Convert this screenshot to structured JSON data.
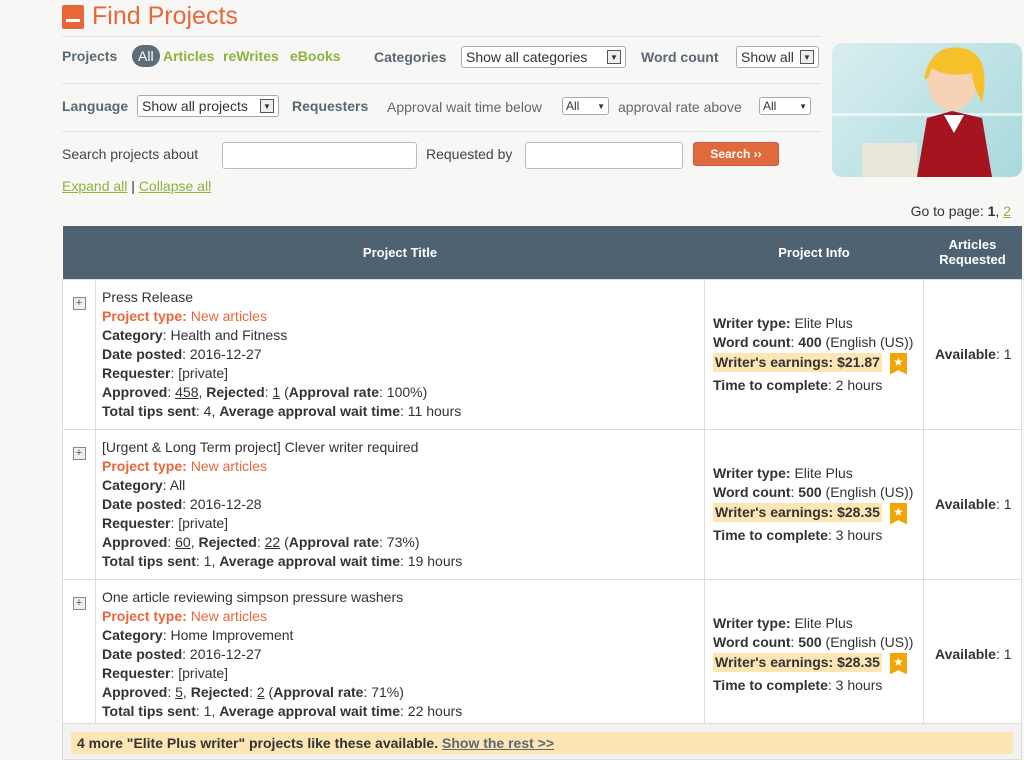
{
  "header": {
    "title": "Find Projects",
    "logo_icon": "notebook-pencil-icon"
  },
  "filters": {
    "projects_label": "Projects",
    "project_tabs": [
      "All",
      "Articles",
      "reWrites",
      "eBooks"
    ],
    "categories_label": "Categories",
    "categories_value": "Show all categories",
    "word_count_label": "Word count",
    "word_count_value": "Show all",
    "language_label": "Language",
    "language_value": "Show all projects",
    "requesters_label": "Requesters",
    "approval_wait_label": "Approval wait time below",
    "approval_wait_value": "All",
    "approval_rate_label": "approval rate above",
    "approval_rate_value": "All",
    "search_label": "Search projects about",
    "search_value": "",
    "requested_by_label": "Requested by",
    "requested_by_value": "",
    "search_button": "Search ››",
    "expand_all": "Expand all",
    "separator": "|",
    "collapse_all": "Collapse all"
  },
  "pagination": {
    "label": "Go to page:",
    "current": "1",
    "other": "2"
  },
  "table": {
    "headers": [
      "Project Title",
      "Project Info",
      "Articles Requested"
    ],
    "rows": [
      {
        "title": "Press Release",
        "type": "New articles",
        "category": "Health and Fitness",
        "date": "2016-12-27",
        "requester": "[private]",
        "approved": "458",
        "rejected": "1",
        "rate": "100%",
        "tips": "4",
        "wait": "11 hours",
        "writer_type": "Elite Plus",
        "word_count": "400",
        "language": "(English (US))",
        "earnings": "$21.87",
        "time": "2 hours",
        "available": "1"
      },
      {
        "title": "[Urgent & Long Term project] Clever writer required",
        "type": "New articles",
        "category": "All",
        "date": "2016-12-28",
        "requester": "[private]",
        "approved": "60",
        "rejected": "22",
        "rate": "73%",
        "tips": "1",
        "wait": "19 hours",
        "writer_type": "Elite Plus",
        "word_count": "500",
        "language": "(English (US))",
        "earnings": "$28.35",
        "time": "3 hours",
        "available": "1"
      },
      {
        "title": "One article reviewing simpson pressure washers",
        "type": "New articles",
        "category": "Home Improvement",
        "date": "2016-12-27",
        "requester": "[private]",
        "approved": "5",
        "rejected": "2",
        "rate": "71%",
        "tips": "1",
        "wait": "22 hours",
        "writer_type": "Elite Plus",
        "word_count": "500",
        "language": "(English (US))",
        "earnings": "$28.35",
        "time": "3 hours",
        "available": "1"
      }
    ]
  },
  "footer": {
    "text": "4 more \"Elite Plus writer\" projects like these available.",
    "link": "Show the rest >>"
  },
  "colors": {
    "accent": "#e8673a",
    "green": "#8db33a",
    "header": "#4f6272",
    "highlight": "#fde6b4"
  }
}
